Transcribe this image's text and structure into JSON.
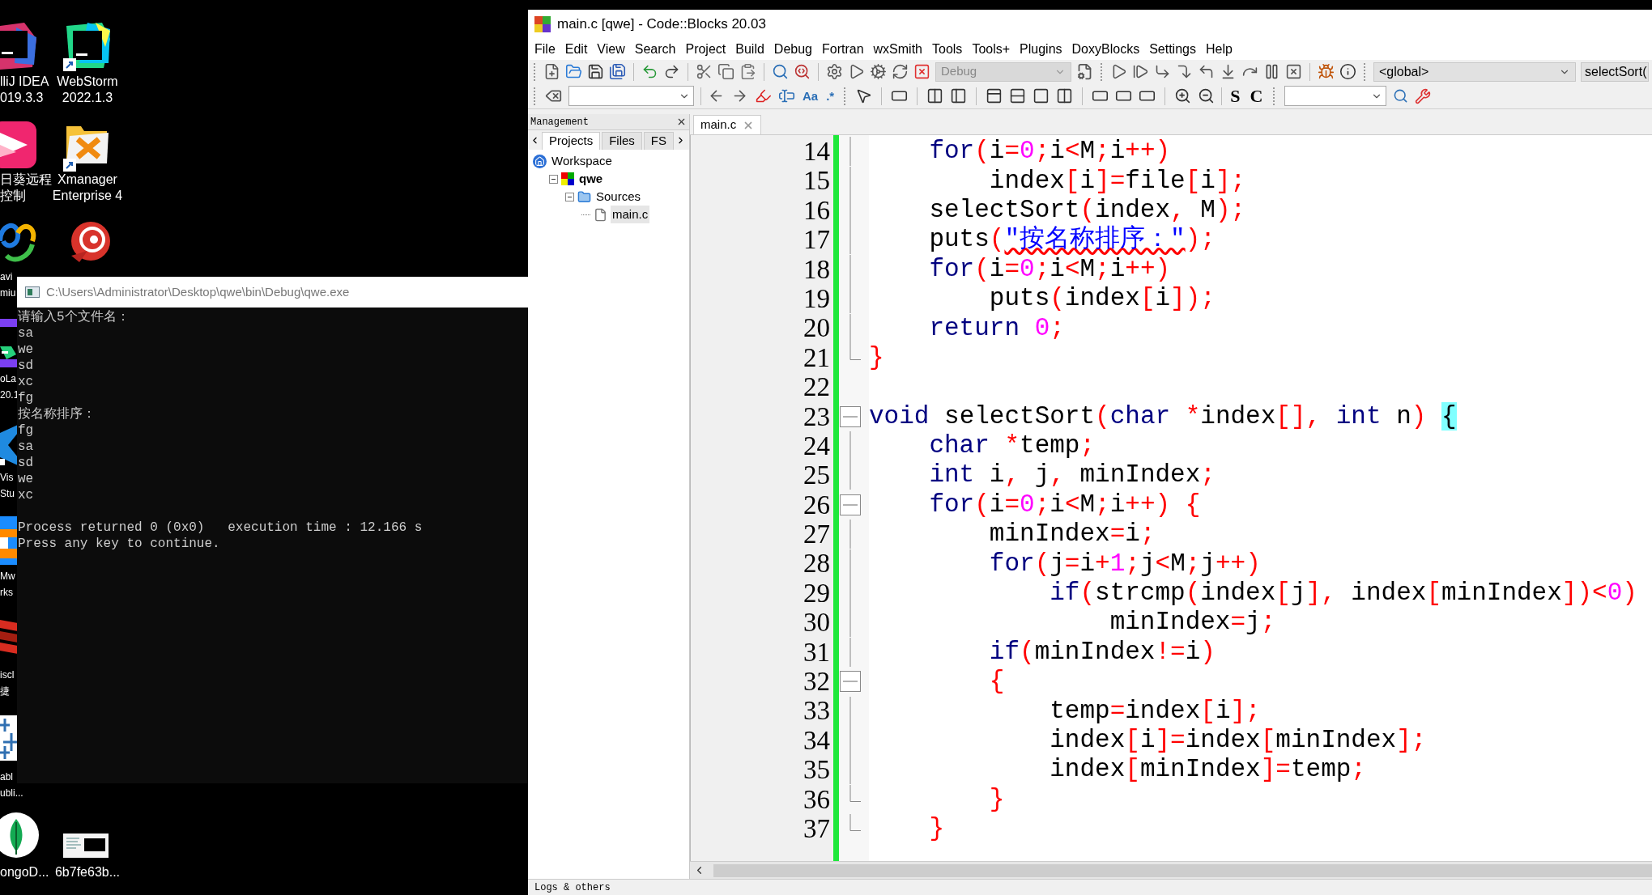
{
  "desktop": {
    "icons": [
      {
        "label_lines": [
          "lliJ IDEA",
          "019.3.3"
        ]
      },
      {
        "label_lines": [
          "WebStorm",
          "2022.1.3"
        ]
      },
      {
        "label_lines": [
          "日葵远程",
          "控制"
        ]
      },
      {
        "label_lines": [
          "Xmanager",
          "Enterprise 4"
        ]
      },
      {
        "label_lines": [
          "avi",
          "miu"
        ]
      },
      {
        "label_lines": [
          "oLa",
          "20.1"
        ]
      },
      {
        "label_lines": [
          "Vis",
          "Stu"
        ]
      },
      {
        "label_lines": [
          "Mw",
          "rks"
        ]
      },
      {
        "label_lines": [
          "iscl",
          "捷"
        ]
      },
      {
        "label_lines": [
          "abl",
          "ubli..."
        ]
      },
      {
        "label_lines": [
          "ongoD..."
        ]
      },
      {
        "label_lines": [
          "6b7fe63b..."
        ]
      }
    ]
  },
  "console_window": {
    "title": "C:\\Users\\Administrator\\Desktop\\qwe\\bin\\Debug\\qwe.exe",
    "output_blocks": [
      [
        "请输入5个文件名：",
        "sa",
        "we",
        "sd",
        "xc",
        "fg",
        "按名称排序：",
        "fg",
        "sa",
        "sd",
        "we",
        "xc"
      ],
      [
        "Process returned 0 (0x0)   execution time : 12.166 s",
        "Press any key to continue."
      ]
    ]
  },
  "codeblocks_window": {
    "title": "main.c [qwe] - Code::Blocks 20.03",
    "menu": [
      "File",
      "Edit",
      "View",
      "Search",
      "Project",
      "Build",
      "Debug",
      "Fortran",
      "wxSmith",
      "Tools",
      "Tools+",
      "Plugins",
      "DoxyBlocks",
      "Settings",
      "Help"
    ],
    "toolbar": {
      "build_target": "Debug",
      "scope": "<global>",
      "function": "selectSort(",
      "text_buttons": [
        "Aa",
        ".*"
      ],
      "letter_buttons": [
        "S",
        "C"
      ]
    },
    "management": {
      "title": "Management",
      "tabs": [
        {
          "label": "Projects",
          "selected": true
        },
        {
          "label": "Files",
          "selected": false
        },
        {
          "label": "FS",
          "selected": false
        }
      ],
      "tree": [
        {
          "label": "Workspace",
          "kind": "workspace",
          "selected": false,
          "children": [
            {
              "label": "qwe",
              "kind": "project",
              "selected": false,
              "children": [
                {
                  "label": "Sources",
                  "kind": "folder",
                  "selected": false,
                  "children": [
                    {
                      "label": "main.c",
                      "kind": "file",
                      "selected": true
                    }
                  ]
                }
              ]
            }
          ]
        }
      ]
    },
    "editor": {
      "tabs": [
        {
          "label": "main.c",
          "selected": true
        }
      ],
      "lines": [
        {
          "number": "14",
          "kind": "fold_body",
          "tokens": [
            {
              "kind": "keyword",
              "text": "    for"
            },
            {
              "kind": "operator",
              "text": "("
            },
            {
              "kind": "plain",
              "text": "i"
            },
            {
              "kind": "operator",
              "text": "="
            },
            {
              "kind": "number",
              "text": "0"
            },
            {
              "kind": "operator",
              "text": ";"
            },
            {
              "kind": "plain",
              "text": "i"
            },
            {
              "kind": "operator",
              "text": "<"
            },
            {
              "kind": "plain",
              "text": "M"
            },
            {
              "kind": "operator",
              "text": ";"
            },
            {
              "kind": "plain",
              "text": "i"
            },
            {
              "kind": "operator",
              "text": "++)"
            }
          ]
        },
        {
          "number": "15",
          "kind": "fold_body",
          "tokens": [
            {
              "kind": "plain",
              "text": "        index"
            },
            {
              "kind": "operator",
              "text": "["
            },
            {
              "kind": "plain",
              "text": "i"
            },
            {
              "kind": "operator",
              "text": "]="
            },
            {
              "kind": "plain",
              "text": "file"
            },
            {
              "kind": "operator",
              "text": "["
            },
            {
              "kind": "plain",
              "text": "i"
            },
            {
              "kind": "operator",
              "text": "];"
            }
          ]
        },
        {
          "number": "16",
          "kind": "fold_body",
          "tokens": [
            {
              "kind": "plain",
              "text": "    selectSort"
            },
            {
              "kind": "operator",
              "text": "("
            },
            {
              "kind": "plain",
              "text": "index"
            },
            {
              "kind": "operator",
              "text": ","
            },
            {
              "kind": "plain",
              "text": " M"
            },
            {
              "kind": "operator",
              "text": ");"
            }
          ]
        },
        {
          "number": "17",
          "kind": "fold_body",
          "tokens": [
            {
              "kind": "plain",
              "text": "    puts"
            },
            {
              "kind": "operator",
              "text": "("
            },
            {
              "kind": "string",
              "text": "\"按名称排序：\""
            },
            {
              "kind": "operator",
              "text": ");"
            }
          ]
        },
        {
          "number": "18",
          "kind": "fold_body",
          "tokens": [
            {
              "kind": "keyword",
              "text": "    for"
            },
            {
              "kind": "operator",
              "text": "("
            },
            {
              "kind": "plain",
              "text": "i"
            },
            {
              "kind": "operator",
              "text": "="
            },
            {
              "kind": "number",
              "text": "0"
            },
            {
              "kind": "operator",
              "text": ";"
            },
            {
              "kind": "plain",
              "text": "i"
            },
            {
              "kind": "operator",
              "text": "<"
            },
            {
              "kind": "plain",
              "text": "M"
            },
            {
              "kind": "operator",
              "text": ";"
            },
            {
              "kind": "plain",
              "text": "i"
            },
            {
              "kind": "operator",
              "text": "++)"
            }
          ]
        },
        {
          "number": "19",
          "kind": "fold_body",
          "tokens": [
            {
              "kind": "plain",
              "text": "        puts"
            },
            {
              "kind": "operator",
              "text": "("
            },
            {
              "kind": "plain",
              "text": "index"
            },
            {
              "kind": "operator",
              "text": "["
            },
            {
              "kind": "plain",
              "text": "i"
            },
            {
              "kind": "operator",
              "text": "]);"
            }
          ]
        },
        {
          "number": "20",
          "kind": "fold_body",
          "tokens": [
            {
              "kind": "keyword",
              "text": "    return"
            },
            {
              "kind": "number",
              "text": " 0"
            },
            {
              "kind": "operator",
              "text": ";"
            }
          ]
        },
        {
          "number": "21",
          "kind": "fold_end",
          "tokens": [
            {
              "kind": "operator",
              "text": "}"
            }
          ]
        },
        {
          "number": "22",
          "kind": "plain"
        },
        {
          "number": "23",
          "kind": "fold_start",
          "tokens": [
            {
              "kind": "keyword",
              "text": "void"
            },
            {
              "kind": "plain",
              "text": " selectSort"
            },
            {
              "kind": "operator",
              "text": "("
            },
            {
              "kind": "keyword",
              "text": "char"
            },
            {
              "kind": "operator",
              "text": " *"
            },
            {
              "kind": "plain",
              "text": "index"
            },
            {
              "kind": "operator",
              "text": "[],"
            },
            {
              "kind": "keyword",
              "text": " int"
            },
            {
              "kind": "plain",
              "text": " n"
            },
            {
              "kind": "operator",
              "text": ") "
            },
            {
              "kind": "brace_match",
              "text": "{"
            }
          ]
        },
        {
          "number": "24",
          "kind": "fold_body",
          "tokens": [
            {
              "kind": "keyword",
              "text": "    char"
            },
            {
              "kind": "operator",
              "text": " *"
            },
            {
              "kind": "plain",
              "text": "temp"
            },
            {
              "kind": "operator",
              "text": ";"
            }
          ]
        },
        {
          "number": "25",
          "kind": "fold_body",
          "tokens": [
            {
              "kind": "keyword",
              "text": "    int"
            },
            {
              "kind": "plain",
              "text": " i"
            },
            {
              "kind": "operator",
              "text": ","
            },
            {
              "kind": "plain",
              "text": " j"
            },
            {
              "kind": "operator",
              "text": ","
            },
            {
              "kind": "plain",
              "text": " minIndex"
            },
            {
              "kind": "operator",
              "text": ";"
            }
          ]
        },
        {
          "number": "26",
          "kind": "fold_start",
          "tokens": [
            {
              "kind": "keyword",
              "text": "    for"
            },
            {
              "kind": "operator",
              "text": "("
            },
            {
              "kind": "plain",
              "text": "i"
            },
            {
              "kind": "operator",
              "text": "="
            },
            {
              "kind": "number",
              "text": "0"
            },
            {
              "kind": "operator",
              "text": ";"
            },
            {
              "kind": "plain",
              "text": "i"
            },
            {
              "kind": "operator",
              "text": "<"
            },
            {
              "kind": "plain",
              "text": "M"
            },
            {
              "kind": "operator",
              "text": ";"
            },
            {
              "kind": "plain",
              "text": "i"
            },
            {
              "kind": "operator",
              "text": "++) {"
            }
          ]
        },
        {
          "number": "27",
          "kind": "fold_body",
          "tokens": [
            {
              "kind": "plain",
              "text": "        minIndex"
            },
            {
              "kind": "operator",
              "text": "="
            },
            {
              "kind": "plain",
              "text": "i"
            },
            {
              "kind": "operator",
              "text": ";"
            }
          ]
        },
        {
          "number": "28",
          "kind": "fold_body",
          "tokens": [
            {
              "kind": "keyword",
              "text": "        for"
            },
            {
              "kind": "operator",
              "text": "("
            },
            {
              "kind": "plain",
              "text": "j"
            },
            {
              "kind": "operator",
              "text": "="
            },
            {
              "kind": "plain",
              "text": "i"
            },
            {
              "kind": "operator",
              "text": "+"
            },
            {
              "kind": "number",
              "text": "1"
            },
            {
              "kind": "operator",
              "text": ";"
            },
            {
              "kind": "plain",
              "text": "j"
            },
            {
              "kind": "operator",
              "text": "<"
            },
            {
              "kind": "plain",
              "text": "M"
            },
            {
              "kind": "operator",
              "text": ";"
            },
            {
              "kind": "plain",
              "text": "j"
            },
            {
              "kind": "operator",
              "text": "++)"
            }
          ]
        },
        {
          "number": "29",
          "kind": "fold_body",
          "tokens": [
            {
              "kind": "keyword",
              "text": "            if"
            },
            {
              "kind": "operator",
              "text": "("
            },
            {
              "kind": "plain",
              "text": "strcmp"
            },
            {
              "kind": "operator",
              "text": "("
            },
            {
              "kind": "plain",
              "text": "index"
            },
            {
              "kind": "operator",
              "text": "["
            },
            {
              "kind": "plain",
              "text": "j"
            },
            {
              "kind": "operator",
              "text": "],"
            },
            {
              "kind": "plain",
              "text": " index"
            },
            {
              "kind": "operator",
              "text": "["
            },
            {
              "kind": "plain",
              "text": "minIndex"
            },
            {
              "kind": "operator",
              "text": "])<"
            },
            {
              "kind": "number",
              "text": "0"
            },
            {
              "kind": "operator",
              "text": ")"
            }
          ]
        },
        {
          "number": "30",
          "kind": "fold_body",
          "tokens": [
            {
              "kind": "plain",
              "text": "                minIndex"
            },
            {
              "kind": "operator",
              "text": "="
            },
            {
              "kind": "plain",
              "text": "j"
            },
            {
              "kind": "operator",
              "text": ";"
            }
          ]
        },
        {
          "number": "31",
          "kind": "fold_body",
          "tokens": [
            {
              "kind": "keyword",
              "text": "        if"
            },
            {
              "kind": "operator",
              "text": "("
            },
            {
              "kind": "plain",
              "text": "minIndex"
            },
            {
              "kind": "operator",
              "text": "!="
            },
            {
              "kind": "plain",
              "text": "i"
            },
            {
              "kind": "operator",
              "text": ")"
            }
          ]
        },
        {
          "number": "32",
          "kind": "fold_start",
          "tokens": [
            {
              "kind": "operator",
              "text": "        {"
            }
          ]
        },
        {
          "number": "33",
          "kind": "fold_body",
          "tokens": [
            {
              "kind": "plain",
              "text": "            temp"
            },
            {
              "kind": "operator",
              "text": "="
            },
            {
              "kind": "plain",
              "text": "index"
            },
            {
              "kind": "operator",
              "text": "["
            },
            {
              "kind": "plain",
              "text": "i"
            },
            {
              "kind": "operator",
              "text": "];"
            }
          ]
        },
        {
          "number": "34",
          "kind": "fold_body",
          "tokens": [
            {
              "kind": "plain",
              "text": "            index"
            },
            {
              "kind": "operator",
              "text": "["
            },
            {
              "kind": "plain",
              "text": "i"
            },
            {
              "kind": "operator",
              "text": "]="
            },
            {
              "kind": "plain",
              "text": "index"
            },
            {
              "kind": "operator",
              "text": "["
            },
            {
              "kind": "plain",
              "text": "minIndex"
            },
            {
              "kind": "operator",
              "text": "];"
            }
          ]
        },
        {
          "number": "35",
          "kind": "fold_body",
          "tokens": [
            {
              "kind": "plain",
              "text": "            index"
            },
            {
              "kind": "operator",
              "text": "["
            },
            {
              "kind": "plain",
              "text": "minIndex"
            },
            {
              "kind": "operator",
              "text": "]="
            },
            {
              "kind": "plain",
              "text": "temp"
            },
            {
              "kind": "operator",
              "text": ";"
            }
          ]
        },
        {
          "number": "36",
          "kind": "fold_end",
          "tokens": [
            {
              "kind": "operator",
              "text": "        }"
            }
          ]
        },
        {
          "number": "37",
          "kind": "fold_end",
          "tokens": [
            {
              "kind": "operator",
              "text": "    }"
            }
          ]
        }
      ]
    },
    "bottom_panel": {
      "title": "Logs & others"
    }
  }
}
